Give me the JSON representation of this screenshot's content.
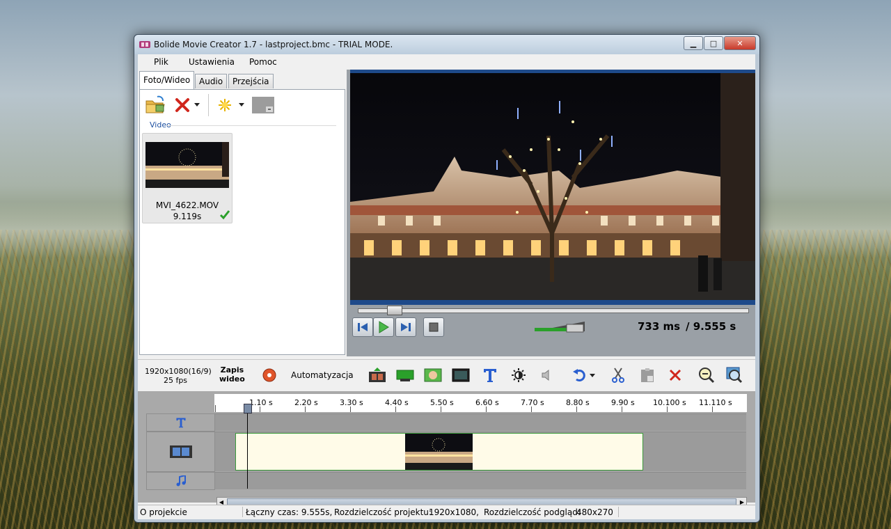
{
  "window": {
    "title": "Bolide Movie Creator 1.7 - lastproject.bmc  - TRIAL MODE.",
    "controls": {
      "minimize": "▁",
      "maximize": "□",
      "close": "✕"
    }
  },
  "menu": [
    "Plik",
    "Ustawienia",
    "Pomoc"
  ],
  "tabs": [
    "Foto/Wideo",
    "Audio",
    "Przejścia"
  ],
  "media": {
    "section_label": "Video",
    "clip": {
      "name": "MVI_4622.MOV",
      "duration": "9.119s",
      "status": "checkmark-icon"
    }
  },
  "player": {
    "current_time": "733 ms",
    "total_time": "/ 9.555 s",
    "seek_fraction": 0.077,
    "volume_level": 0.6
  },
  "toolbar": {
    "resolution": "1920x1080(16/9)",
    "fps": "25 fps",
    "save_line1": "Zapis",
    "save_line2": "wideo",
    "automation": "Automatyzacja"
  },
  "timeline": {
    "ticks": [
      "1.10 s",
      "2.20 s",
      "3.30 s",
      "4.40 s",
      "5.50 s",
      "6.60 s",
      "7.70 s",
      "8.80 s",
      "9.90 s",
      "10.100 s",
      "11.110 s"
    ]
  },
  "status": {
    "about": "O projekcie",
    "total": "Łączny czas: 9.555s,",
    "project_res_label": "Rozdzielczość projektu:",
    "project_res": "1920x1080,",
    "preview_res_label": "Rozdzielczość podgląd:",
    "preview_res": "480x270"
  },
  "colors": {
    "accent_blue": "#1e4a8a",
    "clip_border": "#3a9a3a",
    "clip_fill": "#fffbe8"
  }
}
